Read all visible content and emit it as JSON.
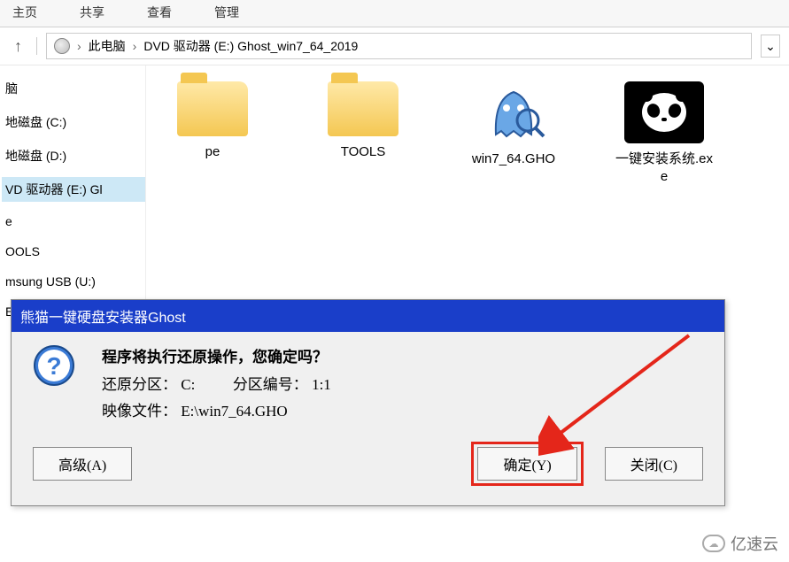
{
  "ribbon": {
    "tabs": [
      "主页",
      "共享",
      "查看",
      "管理"
    ]
  },
  "breadcrumb": {
    "items": [
      "此电脑",
      "DVD 驱动器 (E:) Ghost_win7_64_2019"
    ]
  },
  "tree": {
    "items": [
      "脑",
      "地磁盘 (C:)",
      "地磁盘 (D:)",
      "VD 驱动器 (E:) Gl",
      "e",
      "OOLS",
      "msung USB (U:)",
      "EPF (X:)"
    ],
    "selected_index": 3
  },
  "files": [
    {
      "name": "pe",
      "type": "folder"
    },
    {
      "name": "TOOLS",
      "type": "folder"
    },
    {
      "name": "win7_64.GHO",
      "type": "gho"
    },
    {
      "name": "一键安装系统.exe",
      "type": "panda"
    }
  ],
  "dialog": {
    "title": "熊猫一键硬盘安装器Ghost",
    "message": "程序将执行还原操作，您确定吗？",
    "line2_label": "还原分区：",
    "line2_value": "C:",
    "line2b_label": "分区编号：",
    "line2b_value": "1:1",
    "line3_label": "映像文件：",
    "line3_value": "E:\\win7_64.GHO",
    "btn_advanced": "高级(A)",
    "btn_ok": "确定(Y)",
    "btn_close": "关闭(C)"
  },
  "watermark": "亿速云"
}
